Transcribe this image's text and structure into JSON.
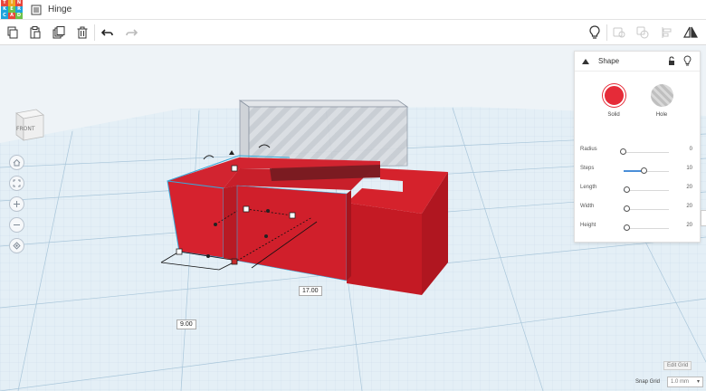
{
  "app": {
    "logo_letters": [
      "T",
      "I",
      "N",
      "K",
      "E",
      "R",
      "C",
      "A",
      "D"
    ],
    "logo_colors": [
      "#e8463c",
      "#f0a31f",
      "#e8463c",
      "#1ea3dc",
      "#6cc24a",
      "#1ea3dc",
      "#1ea3dc",
      "#e8463c",
      "#6cc24a"
    ],
    "title": "Hinge"
  },
  "toolbar": {
    "left_icons": [
      "copy-icon",
      "paste-icon",
      "duplicate-icon",
      "delete-icon",
      "undo-icon",
      "redo-icon"
    ],
    "right_icons": [
      "light-bulb-icon",
      "group-icon",
      "ungroup-icon",
      "align-icon",
      "mirror-icon"
    ]
  },
  "viewcube": {
    "face_label": "FRONT"
  },
  "nav": {
    "icons": [
      "home-view-icon",
      "fit-view-icon",
      "zoom-in-icon",
      "zoom-out-icon",
      "perspective-icon"
    ]
  },
  "dimensions": {
    "width_label": "9.00",
    "depth_label": "17.00"
  },
  "panel": {
    "title": "Shape",
    "solid_label": "Solid",
    "hole_label": "Hole",
    "solid_color": "#e52b38",
    "params": [
      {
        "label": "Radius",
        "value": "0",
        "fraction": 0.0
      },
      {
        "label": "Steps",
        "value": "10",
        "fraction": 0.45
      },
      {
        "label": "Length",
        "value": "20",
        "fraction": 0.08
      },
      {
        "label": "Width",
        "value": "20",
        "fraction": 0.08
      },
      {
        "label": "Height",
        "value": "20",
        "fraction": 0.08
      }
    ]
  },
  "footer": {
    "edit_grid_label": "Edit Grid",
    "snap_grid_label": "Snap Grid",
    "snap_grid_value": "1.0 mm"
  }
}
